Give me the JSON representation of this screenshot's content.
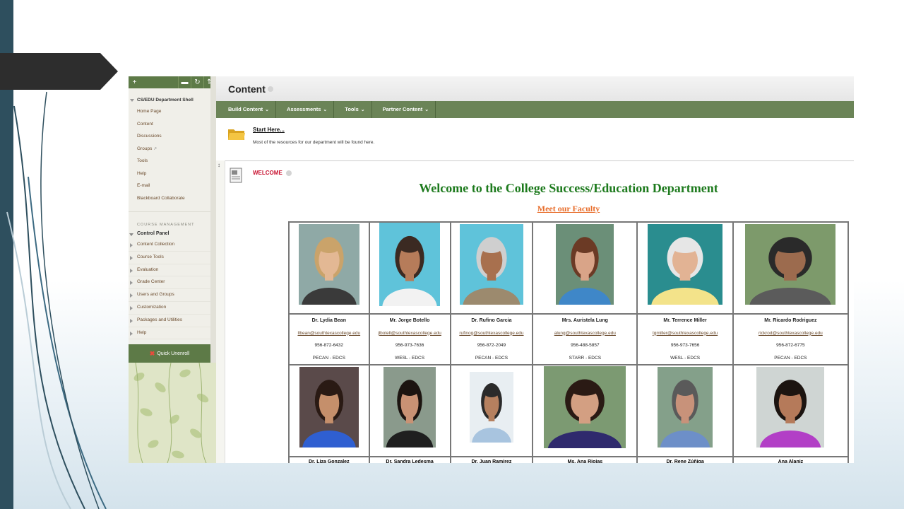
{
  "sidebar": {
    "toolbar_icons": [
      "plus-icon",
      "folder-icon",
      "refresh-icon",
      "sort-icon"
    ],
    "toolbar_glyphs": [
      "+",
      "▬",
      "↻",
      "⇅"
    ],
    "course_title": "CS/EDU Department Shell",
    "links": [
      "Home Page",
      "Content",
      "Discussions",
      "Groups",
      "Tools",
      "Help",
      "E-mail",
      "Blackboard Collaborate"
    ],
    "section_label": "COURSE MANAGEMENT",
    "control_panel": "Control Panel",
    "cp_items": [
      "Content Collection",
      "Course Tools",
      "Evaluation",
      "Grade Center",
      "Users and Groups",
      "Customization",
      "Packages and Utilities",
      "Help"
    ],
    "quick_unenroll": "Quick Unenroll"
  },
  "main": {
    "title": "Content",
    "menu": [
      "Build Content",
      "Assessments",
      "Tools",
      "Partner Content"
    ],
    "item1": {
      "title": "Start Here...",
      "description": "Most of the resources for our department will be found here."
    },
    "item2": {
      "label": "WELCOME",
      "heading": "Welcome to the College Success/Education Department",
      "subheading": "Meet our Faculty"
    }
  },
  "faculty_row1": [
    {
      "name": "Dr. Lydia Bean",
      "email": "llbean@southtexascollege.edu",
      "phone": "956-872-6432",
      "dept": "PECAN - EDCS",
      "bg": "#8fa9a6",
      "shirt": "#3a3a3a",
      "skin": "#e3b894",
      "hair": "#caa36a",
      "w": 86,
      "h": 114
    },
    {
      "name": "Mr. Jorge Botello",
      "email": "jlbotell@southtexascollege.edu",
      "phone": "956-973-7636",
      "dept": "WESL - EDCS",
      "bg": "#5fc3da",
      "shirt": "#f2f2f2",
      "skin": "#b67c5a",
      "hair": "#3b2a22",
      "w": 86,
      "h": 118
    },
    {
      "name": "Dr. Rufino Garcia",
      "email": "rufinog@southtexascollege.edu",
      "phone": "956-872-2049",
      "dept": "PECAN - EDCS",
      "bg": "#5fc3da",
      "shirt": "#9c8a6e",
      "skin": "#a8704e",
      "hair": "#cfcfcf",
      "w": 90,
      "h": 114
    },
    {
      "name": "Mrs. Auristela Lung",
      "email": "alung@southtexascollege.edu",
      "phone": "956-488-5857",
      "dept": "STARR - EDCS",
      "bg": "#6b8f78",
      "shirt": "#3f87c8",
      "skin": "#d9a488",
      "hair": "#6b3a25",
      "w": 82,
      "h": 114
    },
    {
      "name": "Mr. Terrence Miller",
      "email": "tgmiller@southtexascollege.edu",
      "phone": "956-973-7656",
      "dept": "WESL - EDCS",
      "bg": "#2a8d8f",
      "shirt": "#f3e38a",
      "skin": "#e2b394",
      "hair": "#e6e6e6",
      "w": 106,
      "h": 114
    },
    {
      "name": "Mr. Ricardo Rodriguez",
      "email": "rickrod@southtexascollege.edu",
      "phone": "956-872-6775",
      "dept": "PECAN - EDCS",
      "bg": "#7d9a6b",
      "shirt": "#5b5b5b",
      "skin": "#9c6b4e",
      "hair": "#2a2a2a",
      "w": 128,
      "h": 114
    }
  ],
  "faculty_row2": [
    {
      "name": "Dr. Liza Gonzalez",
      "bg": "#5a4a4a",
      "shirt": "#2f5fd1",
      "skin": "#c58f6b",
      "hair": "#2a1a14",
      "w": 84,
      "h": 114
    },
    {
      "name": "Dr. Sandra Ledesma",
      "bg": "#8a9a8c",
      "shirt": "#1f1f1f",
      "skin": "#c99274",
      "hair": "#1c1410",
      "w": 74,
      "h": 114
    },
    {
      "name": "Dr. Juan Ramirez",
      "bg": "#e8eef2",
      "shirt": "#a8c4df",
      "skin": "#b5805f",
      "hair": "#2a2a2a",
      "w": 62,
      "h": 100
    },
    {
      "name": "Ms. Ana Riojas",
      "bg": "#7c9a72",
      "shirt": "#2f2a6d",
      "skin": "#d39f82",
      "hair": "#2a1a14",
      "w": 116,
      "h": 116
    },
    {
      "name": "Dr. Rene Zúñiga",
      "bg": "#84a08a",
      "shirt": "#6d8fc8",
      "skin": "#c8927a",
      "hair": "#5a5a5a",
      "w": 78,
      "h": 114
    },
    {
      "name": "Ana Alaniz",
      "bg": "#cfd5d3",
      "shirt": "#b23fc6",
      "skin": "#b57a5a",
      "hair": "#1c1410",
      "w": 96,
      "h": 114
    }
  ]
}
